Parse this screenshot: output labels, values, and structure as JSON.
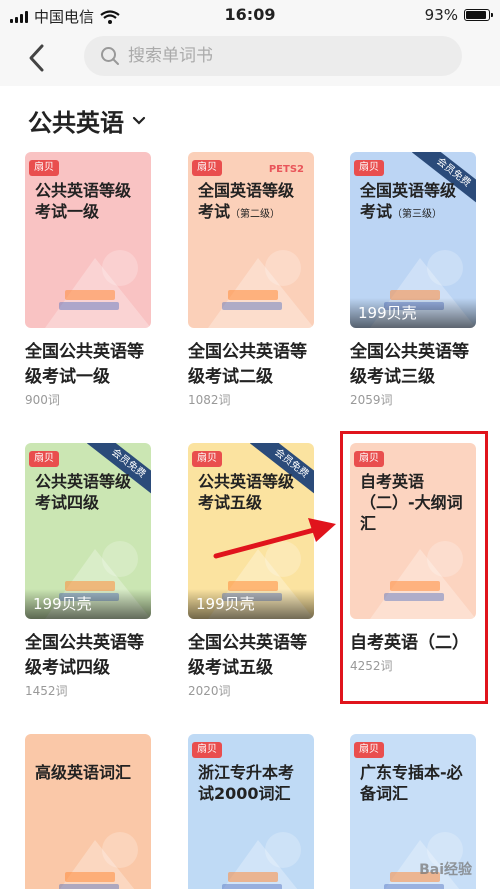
{
  "status_bar": {
    "carrier": "中国电信",
    "time": "16:09",
    "battery": "93%",
    "battery_level": 0.93
  },
  "header": {
    "search_placeholder": "搜索单词书"
  },
  "category": {
    "title": "公共英语"
  },
  "books": [
    {
      "cover_title": "公共英语等级考试一级",
      "cover_sub": "",
      "logo": "扇贝",
      "name": "全国公共英语等级考试一级",
      "count": "900词",
      "price": "",
      "ribbon": "",
      "pets": "",
      "bg": "#f9c3c3"
    },
    {
      "cover_title": "全国英语等级考试",
      "cover_sub": "（第二级）",
      "logo": "扇贝",
      "name": "全国公共英语等级考试二级",
      "count": "1082词",
      "price": "",
      "ribbon": "",
      "pets": "PETS2",
      "bg": "#fbd0b9"
    },
    {
      "cover_title": "全国英语等级考试",
      "cover_sub": "（第三级）",
      "logo": "扇贝",
      "name": "全国公共英语等级考试三级",
      "count": "2059词",
      "price": "199贝壳",
      "ribbon": "会员免费",
      "pets": "",
      "bg": "#bcd5f4"
    },
    {
      "cover_title": "公共英语等级考试四级",
      "cover_sub": "",
      "logo": "扇贝",
      "name": "全国公共英语等级考试四级",
      "count": "1452词",
      "price": "199贝壳",
      "ribbon": "会员免费",
      "pets": "",
      "bg": "#cbe6b3"
    },
    {
      "cover_title": "公共英语等级考试五级",
      "cover_sub": "",
      "logo": "扇贝",
      "name": "全国公共英语等级考试五级",
      "count": "2020词",
      "price": "199贝壳",
      "ribbon": "会员免费",
      "pets": "",
      "bg": "#fbe3a0"
    },
    {
      "cover_title": "自考英语（二）-大纲词汇",
      "cover_sub": "",
      "logo": "扇贝",
      "name": "自考英语（二）",
      "count": "4252词",
      "price": "",
      "ribbon": "",
      "pets": "",
      "bg": "#fcd4c0"
    },
    {
      "cover_title": "高级英语词汇",
      "cover_sub": "",
      "logo": "",
      "name": "",
      "count": "",
      "price": "",
      "ribbon": "",
      "pets": "",
      "bg": "#fac8a8"
    },
    {
      "cover_title": "浙江专升本考试2000词汇",
      "cover_sub": "",
      "logo": "扇贝",
      "name": "",
      "count": "",
      "price": "",
      "ribbon": "",
      "pets": "",
      "bg": "#bfdaf5"
    },
    {
      "cover_title": "广东专插本-必备词汇",
      "cover_sub": "",
      "logo": "扇贝",
      "name": "",
      "count": "",
      "price": "",
      "ribbon": "",
      "pets": "",
      "bg": "#c7def7"
    }
  ],
  "colors": {
    "highlight_border": "#e0141c",
    "logo_red": "#e94e4e",
    "ribbon_blue": "#2b4b7a"
  },
  "icons": [
    "signal-icon",
    "wifi-icon",
    "battery-icon",
    "back-chevron-icon",
    "search-icon",
    "chevron-down-icon",
    "arrow-annotation"
  ],
  "watermark": "Bai经验"
}
